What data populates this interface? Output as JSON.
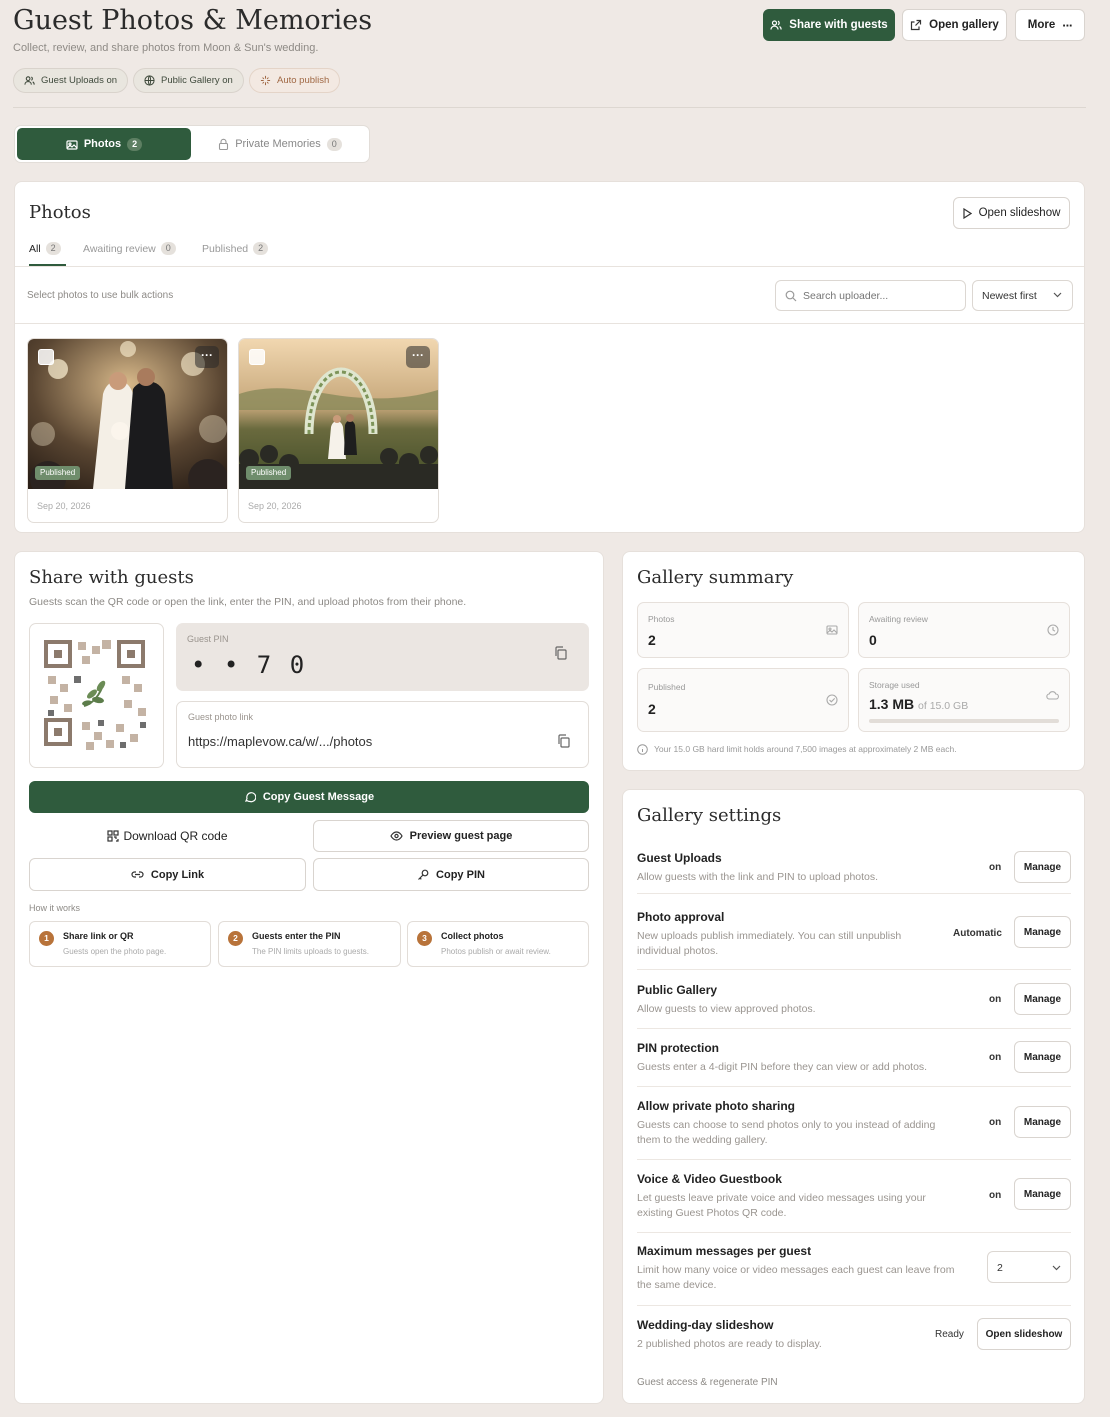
{
  "header": {
    "title": "Guest Photos & Memories",
    "subtitle": "Collect, review, and share photos from Moon & Sun's wedding.",
    "pills": [
      "Guest Uploads on",
      "Public Gallery on",
      "Auto publish"
    ],
    "share_label": "Share with guests",
    "open_gallery_label": "Open gallery",
    "more_label": "More"
  },
  "main_tabs": [
    {
      "label": "Photos",
      "count": "2"
    },
    {
      "label": "Private Memories",
      "count": "0"
    }
  ],
  "photos_panel": {
    "title": "Photos",
    "slideshow_label": "Open slideshow",
    "filters": [
      {
        "label": "All",
        "count": "2"
      },
      {
        "label": "Awaiting review",
        "count": "0"
      },
      {
        "label": "Published",
        "count": "2"
      }
    ],
    "bulk_hint": "Select photos to use bulk actions",
    "search_placeholder": "Search uploader...",
    "sort_label": "Newest first",
    "photos": [
      {
        "status": "Published",
        "date": "Sep 20, 2026"
      },
      {
        "status": "Published",
        "date": "Sep 20, 2026"
      }
    ]
  },
  "share": {
    "title": "Share with guests",
    "description": "Guests scan the QR code or open the link, enter the PIN, and upload photos from their phone.",
    "pin_label": "Guest PIN",
    "pin_value": "• • 7 0",
    "link_label": "Guest photo link",
    "link_value": "https://maplevow.ca/w/.../photos",
    "copy_message_label": "Copy Guest Message",
    "download_qr_label": "Download QR code",
    "preview_label": "Preview guest page",
    "copy_link_label": "Copy Link",
    "copy_pin_label": "Copy PIN",
    "how_title": "How it works",
    "steps": [
      {
        "num": "1",
        "title": "Share link or QR",
        "desc": "Guests open the photo page."
      },
      {
        "num": "2",
        "title": "Guests enter the PIN",
        "desc": "The PIN limits uploads to guests."
      },
      {
        "num": "3",
        "title": "Collect photos",
        "desc": "Photos publish or await review."
      }
    ]
  },
  "summary": {
    "title": "Gallery summary",
    "photos_label": "Photos",
    "photos_value": "2",
    "awaiting_label": "Awaiting review",
    "awaiting_value": "0",
    "published_label": "Published",
    "published_value": "2",
    "storage_label": "Storage used",
    "storage_value": "1.3 MB",
    "storage_of": "of 15.0 GB",
    "storage_fraction": 0.0001,
    "note": "Your 15.0 GB hard limit holds around 7,500 images at approximately 2 MB each."
  },
  "settings": {
    "title": "Gallery settings",
    "manage_label": "Manage",
    "rows": [
      {
        "title": "Guest Uploads",
        "desc": "Allow guests with the link and PIN to upload photos.",
        "status": "on"
      },
      {
        "title": "Photo approval",
        "desc": "New uploads publish immediately. You can still unpublish individual photos.",
        "status": "Automatic"
      },
      {
        "title": "Public Gallery",
        "desc": "Allow guests to view approved photos.",
        "status": "on"
      },
      {
        "title": "PIN protection",
        "desc": "Guests enter a 4-digit PIN before they can view or add photos.",
        "status": "on"
      },
      {
        "title": "Allow private photo sharing",
        "desc": "Guests can choose to send photos only to you instead of adding them to the wedding gallery.",
        "status": "on"
      },
      {
        "title": "Voice & Video Guestbook",
        "desc": "Let guests leave private voice and video messages using your existing Guest Photos QR code.",
        "status": "on"
      }
    ],
    "max_messages": {
      "title": "Maximum messages per guest",
      "desc": "Limit how many voice or video messages each guest can leave from the same device.",
      "value": "2"
    },
    "slideshow": {
      "title": "Wedding-day slideshow",
      "desc": "2 published photos are ready to display.",
      "status": "Ready",
      "button": "Open slideshow"
    },
    "footer_link": "Guest access & regenerate PIN"
  },
  "colors": {
    "accent": "#2f5b3d",
    "step": "#b8733a",
    "published": "#6f8d6c"
  }
}
